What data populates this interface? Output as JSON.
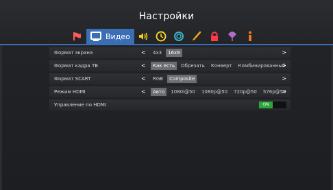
{
  "title": "Настройки",
  "tabs": [
    {
      "icon": "flag-icon"
    },
    {
      "icon": "monitor-icon",
      "label": "Видео",
      "active": true
    },
    {
      "icon": "speaker-icon"
    },
    {
      "icon": "clock-icon"
    },
    {
      "icon": "network-icon"
    },
    {
      "icon": "brush-icon"
    },
    {
      "icon": "lock-icon"
    },
    {
      "icon": "balloon-icon"
    },
    {
      "icon": "info-icon"
    }
  ],
  "rows": [
    {
      "label": "Формат экрана",
      "options": [
        "4x3",
        "16x9"
      ],
      "selected": 1
    },
    {
      "label": "Формат кадра ТВ",
      "options": [
        "Как есть",
        "Обрезать",
        "Конверт",
        "Комбинированный"
      ],
      "selected": 0
    },
    {
      "label": "Формат SCART",
      "options": [
        "RGB",
        "Composite"
      ],
      "selected": 1
    },
    {
      "label": "Режим HDMI",
      "options": [
        "Авто",
        "1080i@50",
        "1080p@50",
        "720p@50",
        "576p@50"
      ],
      "selected": 0
    },
    {
      "label": "Управление по HDMI",
      "toggle": "ON"
    }
  ],
  "colors": {
    "accent": "#3a6fb6",
    "toggle_on": "#2aa63a"
  }
}
